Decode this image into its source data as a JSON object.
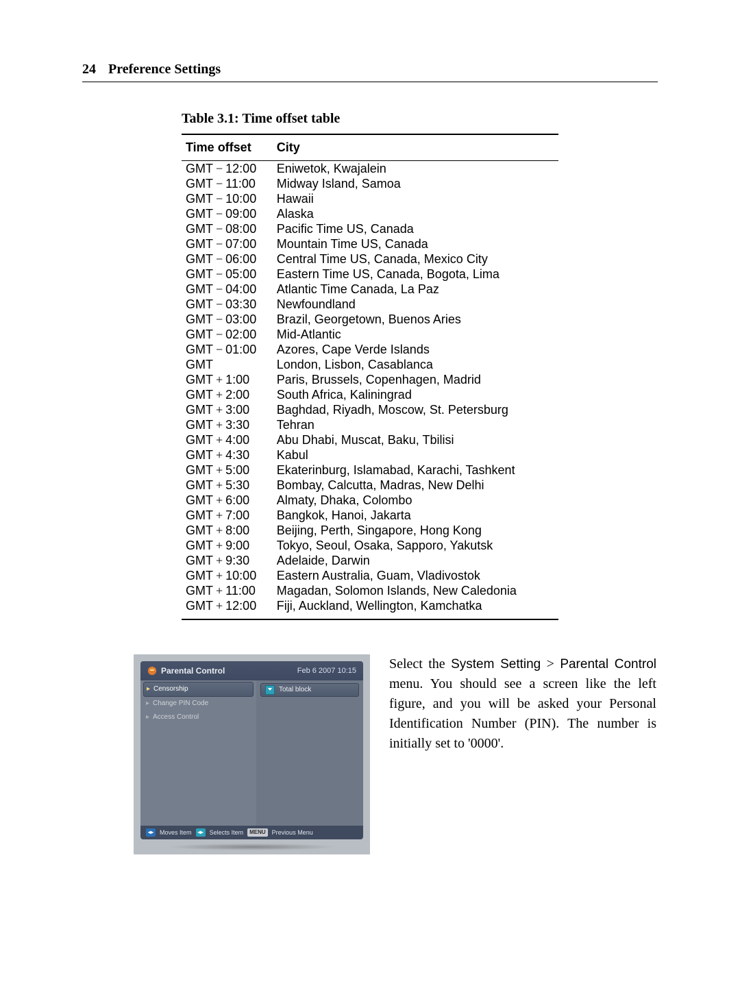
{
  "header": {
    "page_number": "24",
    "chapter_title": "Preference Settings"
  },
  "table": {
    "caption": "Table 3.1: Time offset table",
    "columns": {
      "offset": "Time offset",
      "city": "City"
    },
    "gmt_label": "GMT",
    "rows": [
      {
        "sign": "−",
        "time": "12:00",
        "city": "Eniwetok, Kwajalein"
      },
      {
        "sign": "−",
        "time": "11:00",
        "city": "Midway Island, Samoa"
      },
      {
        "sign": "−",
        "time": "10:00",
        "city": "Hawaii"
      },
      {
        "sign": "−",
        "time": "09:00",
        "city": "Alaska"
      },
      {
        "sign": "−",
        "time": "08:00",
        "city": "Pacific Time US, Canada"
      },
      {
        "sign": "−",
        "time": "07:00",
        "city": "Mountain Time US, Canada"
      },
      {
        "sign": "−",
        "time": "06:00",
        "city": "Central Time US, Canada, Mexico City"
      },
      {
        "sign": "−",
        "time": "05:00",
        "city": "Eastern Time US, Canada, Bogota, Lima"
      },
      {
        "sign": "−",
        "time": "04:00",
        "city": "Atlantic Time Canada, La Paz"
      },
      {
        "sign": "−",
        "time": "03:30",
        "city": "Newfoundland"
      },
      {
        "sign": "−",
        "time": "03:00",
        "city": "Brazil, Georgetown, Buenos Aries"
      },
      {
        "sign": "−",
        "time": "02:00",
        "city": "Mid-Atlantic"
      },
      {
        "sign": "−",
        "time": "01:00",
        "city": "Azores, Cape Verde Islands"
      },
      {
        "sign": "",
        "time": "",
        "city": "London, Lisbon, Casablanca"
      },
      {
        "sign": "+",
        "time": "1:00",
        "city": "Paris, Brussels, Copenhagen, Madrid"
      },
      {
        "sign": "+",
        "time": "2:00",
        "city": "South Africa, Kaliningrad"
      },
      {
        "sign": "+",
        "time": "3:00",
        "city": "Baghdad, Riyadh, Moscow, St. Petersburg"
      },
      {
        "sign": "+",
        "time": "3:30",
        "city": "Tehran"
      },
      {
        "sign": "+",
        "time": "4:00",
        "city": "Abu Dhabi, Muscat, Baku, Tbilisi"
      },
      {
        "sign": "+",
        "time": "4:30",
        "city": "Kabul"
      },
      {
        "sign": "+",
        "time": "5:00",
        "city": "Ekaterinburg, Islamabad, Karachi, Tashkent"
      },
      {
        "sign": "+",
        "time": "5:30",
        "city": "Bombay, Calcutta, Madras, New Delhi"
      },
      {
        "sign": "+",
        "time": "6:00",
        "city": "Almaty, Dhaka, Colombo"
      },
      {
        "sign": "+",
        "time": "7:00",
        "city": "Bangkok, Hanoi, Jakarta"
      },
      {
        "sign": "+",
        "time": "8:00",
        "city": "Beijing, Perth, Singapore, Hong Kong"
      },
      {
        "sign": "+",
        "time": "9:00",
        "city": "Tokyo, Seoul, Osaka, Sapporo, Yakutsk"
      },
      {
        "sign": "+",
        "time": "9:30",
        "city": "Adelaide, Darwin"
      },
      {
        "sign": "+",
        "time": "10:00",
        "city": "Eastern Australia, Guam, Vladivostok"
      },
      {
        "sign": "+",
        "time": "11:00",
        "city": "Magadan, Solomon Islands, New Caledonia"
      },
      {
        "sign": "+",
        "time": "12:00",
        "city": "Fiji, Auckland, Wellington, Kamchatka"
      }
    ]
  },
  "stb": {
    "title": "Parental Control",
    "datetime": "Feb 6 2007 10:15",
    "menu": [
      {
        "label": "Censorship",
        "selected": true
      },
      {
        "label": "Change PIN Code",
        "selected": false
      },
      {
        "label": "Access Control",
        "selected": false
      }
    ],
    "value_label": "Total block",
    "footer": {
      "moves": "Moves Item",
      "selects": "Selects Item",
      "menu_btn": "MENU",
      "prev": "Previous Menu"
    }
  },
  "prose": {
    "txt_select_the": "Select the ",
    "ui_system_setting": "System Setting",
    "txt_gt": " > ",
    "ui_parental_control": "Parental Control",
    "txt_rest": " menu. You should see a screen like the left figure, and you will be asked your Personal Identification Number (PIN). The number is initially set to '0000'."
  }
}
